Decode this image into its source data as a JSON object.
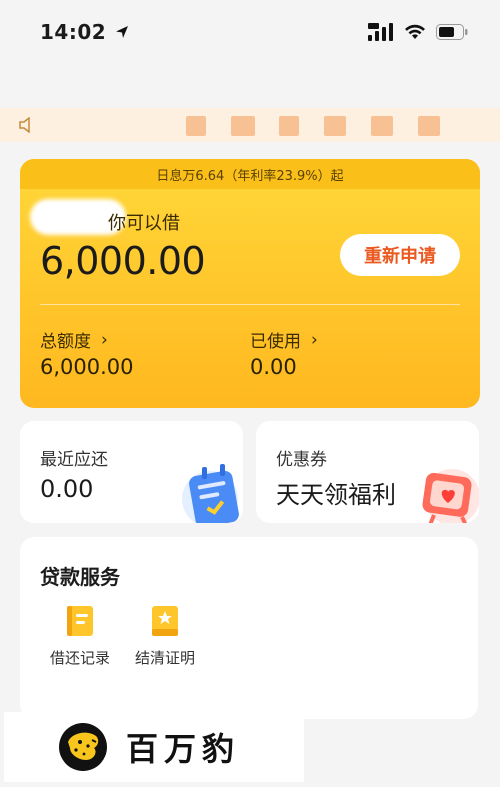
{
  "status_bar": {
    "time": "14:02",
    "location_icon": "navigation-arrow-icon",
    "signal_icon": "cellular-signal-icon",
    "wifi_icon": "wifi-icon",
    "battery_icon": "battery-icon"
  },
  "notice": {
    "icon": "speaker-icon",
    "text": "\u0001"
  },
  "loan": {
    "rate_text": "日息万6.64（年利率23.9%）起",
    "borrow_label": "你可以借",
    "amount": "6,000.00",
    "reapply_label": "重新申请",
    "total_label": "总额度",
    "total_value": "6,000.00",
    "used_label": "已使用",
    "used_value": "0.00",
    "chevron": "›"
  },
  "repay": {
    "title": "最近应还",
    "value": "0.00"
  },
  "coupon": {
    "title": "优惠券",
    "value": "天天领福利"
  },
  "services": {
    "title": "贷款服务",
    "items": [
      {
        "label": "借还记录",
        "icon": "ledger-icon"
      },
      {
        "label": "结清证明",
        "icon": "certificate-icon"
      }
    ]
  },
  "watermark": {
    "text": "百万豹"
  },
  "colors": {
    "accent": "#ea5a20",
    "card_yellow": "#ffc62b",
    "page_bg": "#f4f4f4"
  }
}
